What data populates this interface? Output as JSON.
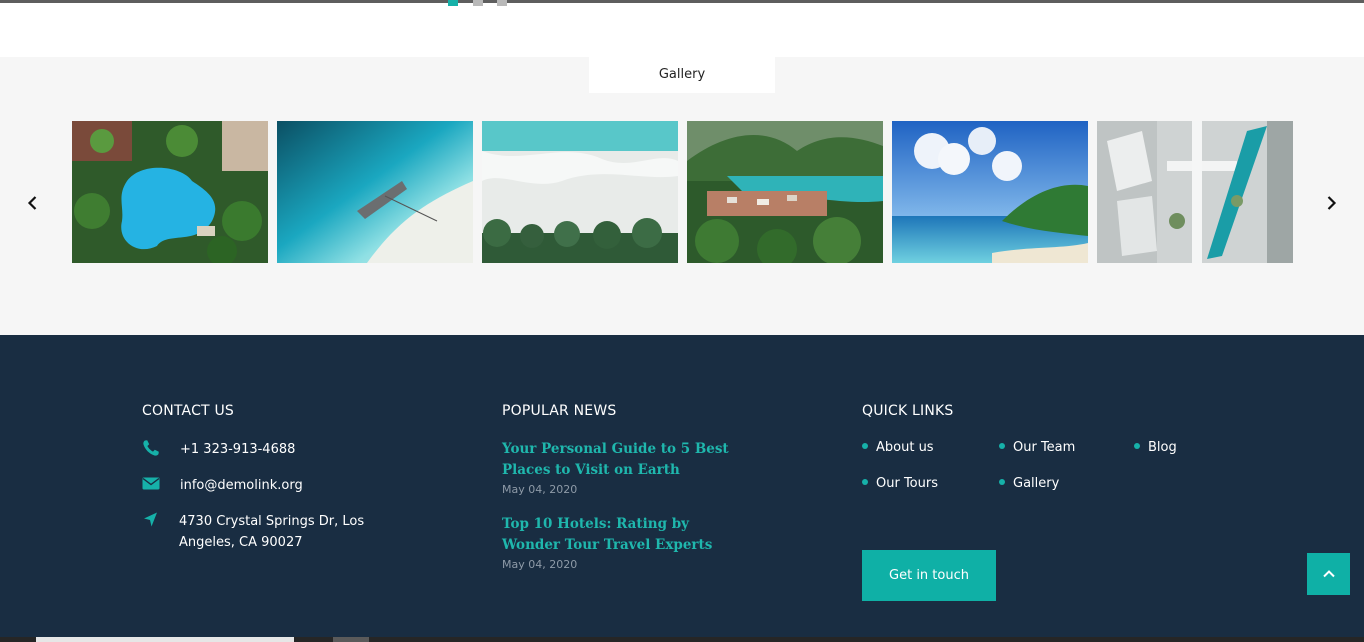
{
  "slider": {
    "dots": [
      {
        "active": true
      },
      {
        "active": false
      },
      {
        "active": false
      }
    ]
  },
  "gallery": {
    "tab_label": "Gallery",
    "images": [
      {
        "icon": "resort-pool-image"
      },
      {
        "icon": "boat-beach-image"
      },
      {
        "icon": "shore-waves-image"
      },
      {
        "icon": "bay-village-image"
      },
      {
        "icon": "blue-sea-sky-image"
      },
      {
        "icon": "aerial-hotel-image"
      }
    ]
  },
  "footer": {
    "contact": {
      "title": "CONTACT US",
      "phone": "+1 323-913-4688",
      "email": "info@demolink.org",
      "address": "4730 Crystal Springs Dr, Los Angeles, CA 90027"
    },
    "news": {
      "title": "POPULAR NEWS",
      "items": [
        {
          "title": "Your Personal Guide to 5 Best Places to Visit on Earth",
          "date": "May 04, 2020"
        },
        {
          "title": "Top 10 Hotels: Rating by Wonder Tour Travel Experts",
          "date": "May 04, 2020"
        }
      ]
    },
    "quick_links": {
      "title": "QUICK LINKS",
      "links": [
        "About us",
        "Our Team",
        "Blog",
        "Our Tours",
        "Gallery"
      ]
    },
    "cta_label": "Get in touch"
  },
  "colors": {
    "accent": "#0fb0a6",
    "footer_bg": "#192d42",
    "gallery_bg": "#f6f6f6"
  }
}
